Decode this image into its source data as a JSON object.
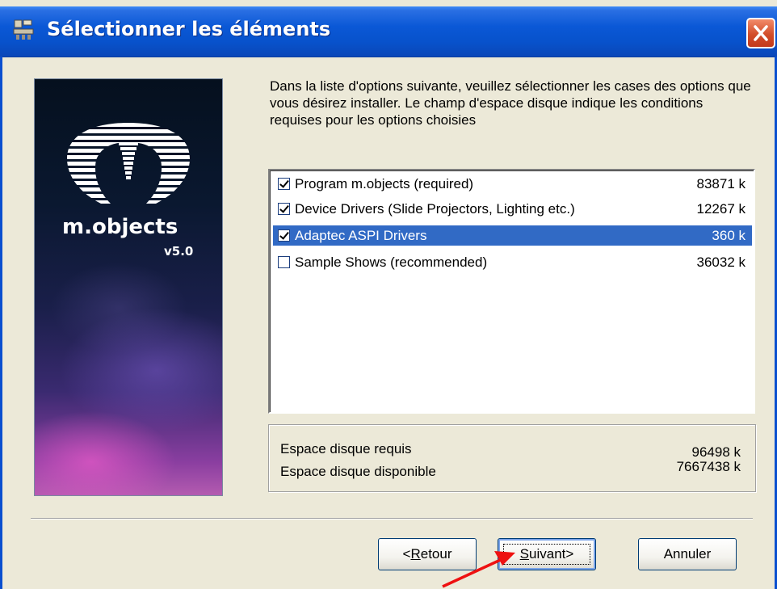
{
  "window": {
    "title": "Sélectionner les éléments"
  },
  "banner": {
    "product_name": "m.objects",
    "version": "v5.0"
  },
  "instructions": "Dans la liste d'options suivante, veuillez sélectionner les cases des options que vous désirez installer. Le champ d'espace disque indique les conditions requises pour les options choisies",
  "components": [
    {
      "label": "Program m.objects (required)",
      "size": "83871 k",
      "checked": true,
      "selected": false
    },
    {
      "label": "Device Drivers (Slide Projectors, Lighting etc.)",
      "size": "12267 k",
      "checked": true,
      "selected": false
    },
    {
      "label": "Adaptec ASPI Drivers",
      "size": "360 k",
      "checked": true,
      "selected": true
    },
    {
      "label": "Sample Shows (recommended)",
      "size": "36032 k",
      "checked": false,
      "selected": false
    }
  ],
  "disk_space": {
    "required_label": "Espace disque requis",
    "required_value": "96498 k",
    "available_label": "Espace disque disponible",
    "available_value": "7667438 k"
  },
  "buttons": {
    "back_accel": "R",
    "back_prefix": "<",
    "back_rest": "etour",
    "next_accel": "S",
    "next_rest": "uivant>",
    "cancel": "Annuler"
  },
  "colors": {
    "titlebar": "#0852cc",
    "selection": "#316ac5",
    "dialog_bg": "#ece9d8",
    "annotation_arrow": "#ee1111"
  },
  "icons": [
    "installer-icon",
    "close-icon",
    "m-objects-logo",
    "checkbox-checked",
    "checkbox-unchecked",
    "red-arrow-annotation"
  ]
}
